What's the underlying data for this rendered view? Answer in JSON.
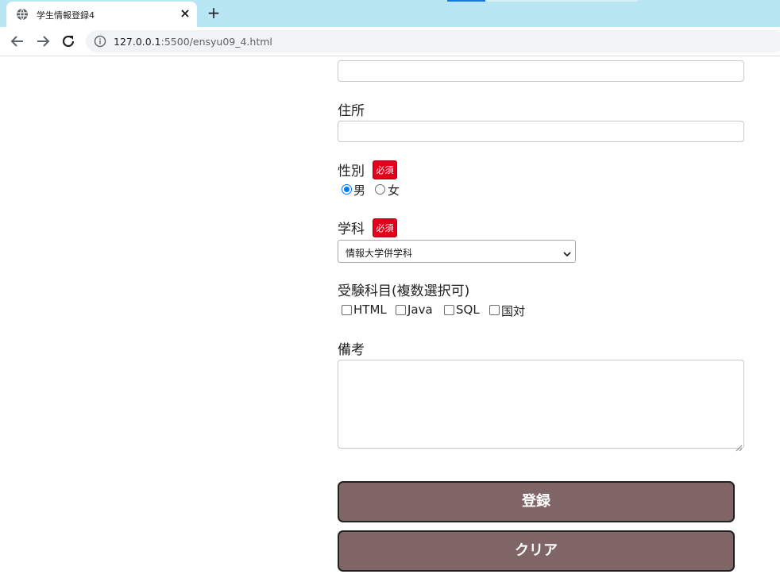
{
  "browser": {
    "tab_title": "学生情報登録4",
    "tab_close": "×",
    "new_tab": "+",
    "url_host": "127.0.0.1",
    "url_rest": ":5500/ensyu09_4.html"
  },
  "form": {
    "address_label": "住所",
    "gender_label": "性別",
    "required_badge": "必須",
    "gender_options": [
      "男",
      "女"
    ],
    "gender_selected": "男",
    "department_label": "学科",
    "department_selected": "情報大学併学科",
    "subjects_label": "受験科目(複数選択可)",
    "subject_options": [
      "HTML",
      "Java",
      "SQL",
      "国対"
    ],
    "remarks_label": "備考",
    "register_button": "登録",
    "clear_button": "クリア"
  },
  "colors": {
    "tabstrip": "#b8e6f2",
    "required_badge": "#e4001b",
    "button_bg": "#806566",
    "radio_accent": "#0075ff"
  }
}
